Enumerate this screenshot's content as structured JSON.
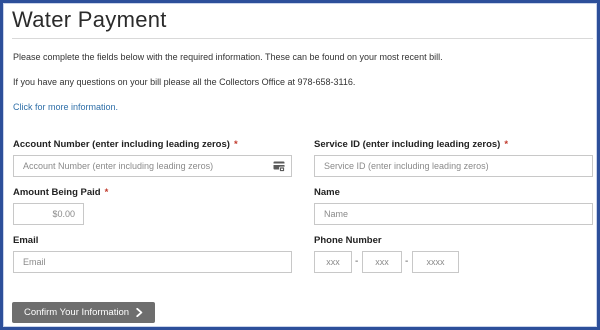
{
  "page": {
    "title": "Water Payment",
    "intro": "Please complete the fields below with the required information. These can be found on your most recent bill.",
    "contact": "If you have any questions on your bill please all the Collectors Office at 978-658-3116.",
    "more_info_link": "Click for more information."
  },
  "form": {
    "required_marker": "*",
    "account_number": {
      "label": "Account Number (enter including leading zeros)",
      "placeholder": "Account Number (enter including leading zeros)",
      "icon": "card-icon"
    },
    "service_id": {
      "label": "Service ID (enter including leading zeros)",
      "placeholder": "Service ID (enter including leading zeros)"
    },
    "amount": {
      "label": "Amount Being Paid",
      "placeholder": "$0.00"
    },
    "name": {
      "label": "Name",
      "placeholder": "Name"
    },
    "email": {
      "label": "Email",
      "placeholder": "Email"
    },
    "phone": {
      "label": "Phone Number",
      "area_placeholder": "xxx",
      "prefix_placeholder": "xxx",
      "line_placeholder": "xxxx",
      "separator": "-"
    },
    "submit_label": "Confirm Your Information",
    "submit_icon": "chevron-right-icon"
  },
  "colors": {
    "border": "#2d4f9a",
    "link": "#2f6fa8",
    "required": "#c0392b",
    "button": "#6e6e6e"
  }
}
